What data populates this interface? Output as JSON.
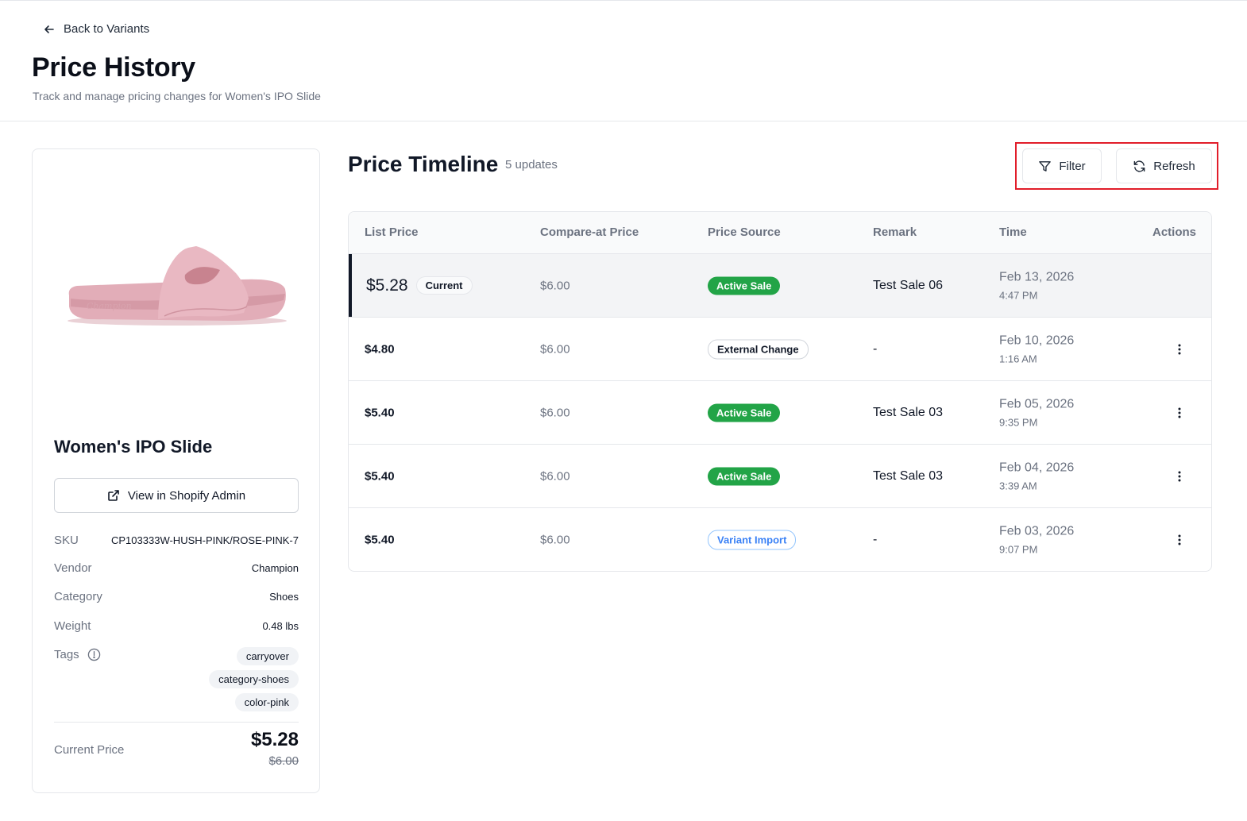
{
  "header": {
    "back_label": "Back to Variants",
    "title": "Price History",
    "subtitle": "Track and manage pricing changes for Women's IPO Slide"
  },
  "product": {
    "name": "Women's IPO Slide",
    "shopify_button": "View in Shopify Admin",
    "meta": {
      "sku_label": "SKU",
      "sku_value": "CP103333W-HUSH-PINK/ROSE-PINK-7",
      "vendor_label": "Vendor",
      "vendor_value": "Champion",
      "category_label": "Category",
      "category_value": "Shoes",
      "weight_label": "Weight",
      "weight_value": "0.48 lbs",
      "tags_label": "Tags"
    },
    "tags": [
      "carryover",
      "category-shoes",
      "color-pink"
    ],
    "current_price_label": "Current Price",
    "current_price": "$5.28",
    "compare_price": "$6.00"
  },
  "timeline": {
    "title": "Price Timeline",
    "count": "5 updates",
    "filter_label": "Filter",
    "refresh_label": "Refresh",
    "columns": [
      "List Price",
      "Compare-at Price",
      "Price Source",
      "Remark",
      "Time",
      "Actions"
    ],
    "rows": [
      {
        "list_price": "$5.28",
        "badge": "Current",
        "compare": "$6.00",
        "source": "Active Sale",
        "source_type": "green",
        "remark": "Test Sale 06",
        "date": "Feb 13, 2026",
        "time": "4:47 PM"
      },
      {
        "list_price": "$4.80",
        "compare": "$6.00",
        "source": "External Change",
        "source_type": "outline",
        "remark": "-",
        "date": "Feb 10, 2026",
        "time": "1:16 AM"
      },
      {
        "list_price": "$5.40",
        "compare": "$6.00",
        "source": "Active Sale",
        "source_type": "green",
        "remark": "Test Sale 03",
        "date": "Feb 05, 2026",
        "time": "9:35 PM"
      },
      {
        "list_price": "$5.40",
        "compare": "$6.00",
        "source": "Active Sale",
        "source_type": "green",
        "remark": "Test Sale 03",
        "date": "Feb 04, 2026",
        "time": "3:39 AM"
      },
      {
        "list_price": "$5.40",
        "compare": "$6.00",
        "source": "Variant Import",
        "source_type": "blue",
        "remark": "-",
        "date": "Feb 03, 2026",
        "time": "9:07 PM"
      }
    ]
  },
  "colors": {
    "active_sale": "#22a447",
    "variant_import": "#3b82f6",
    "highlight_border": "#e11d2a"
  },
  "icons": {
    "back": "arrow-left-icon",
    "external": "external-link-icon",
    "info": "info-icon",
    "filter": "filter-icon",
    "refresh": "refresh-icon",
    "more": "more-vertical-icon"
  }
}
